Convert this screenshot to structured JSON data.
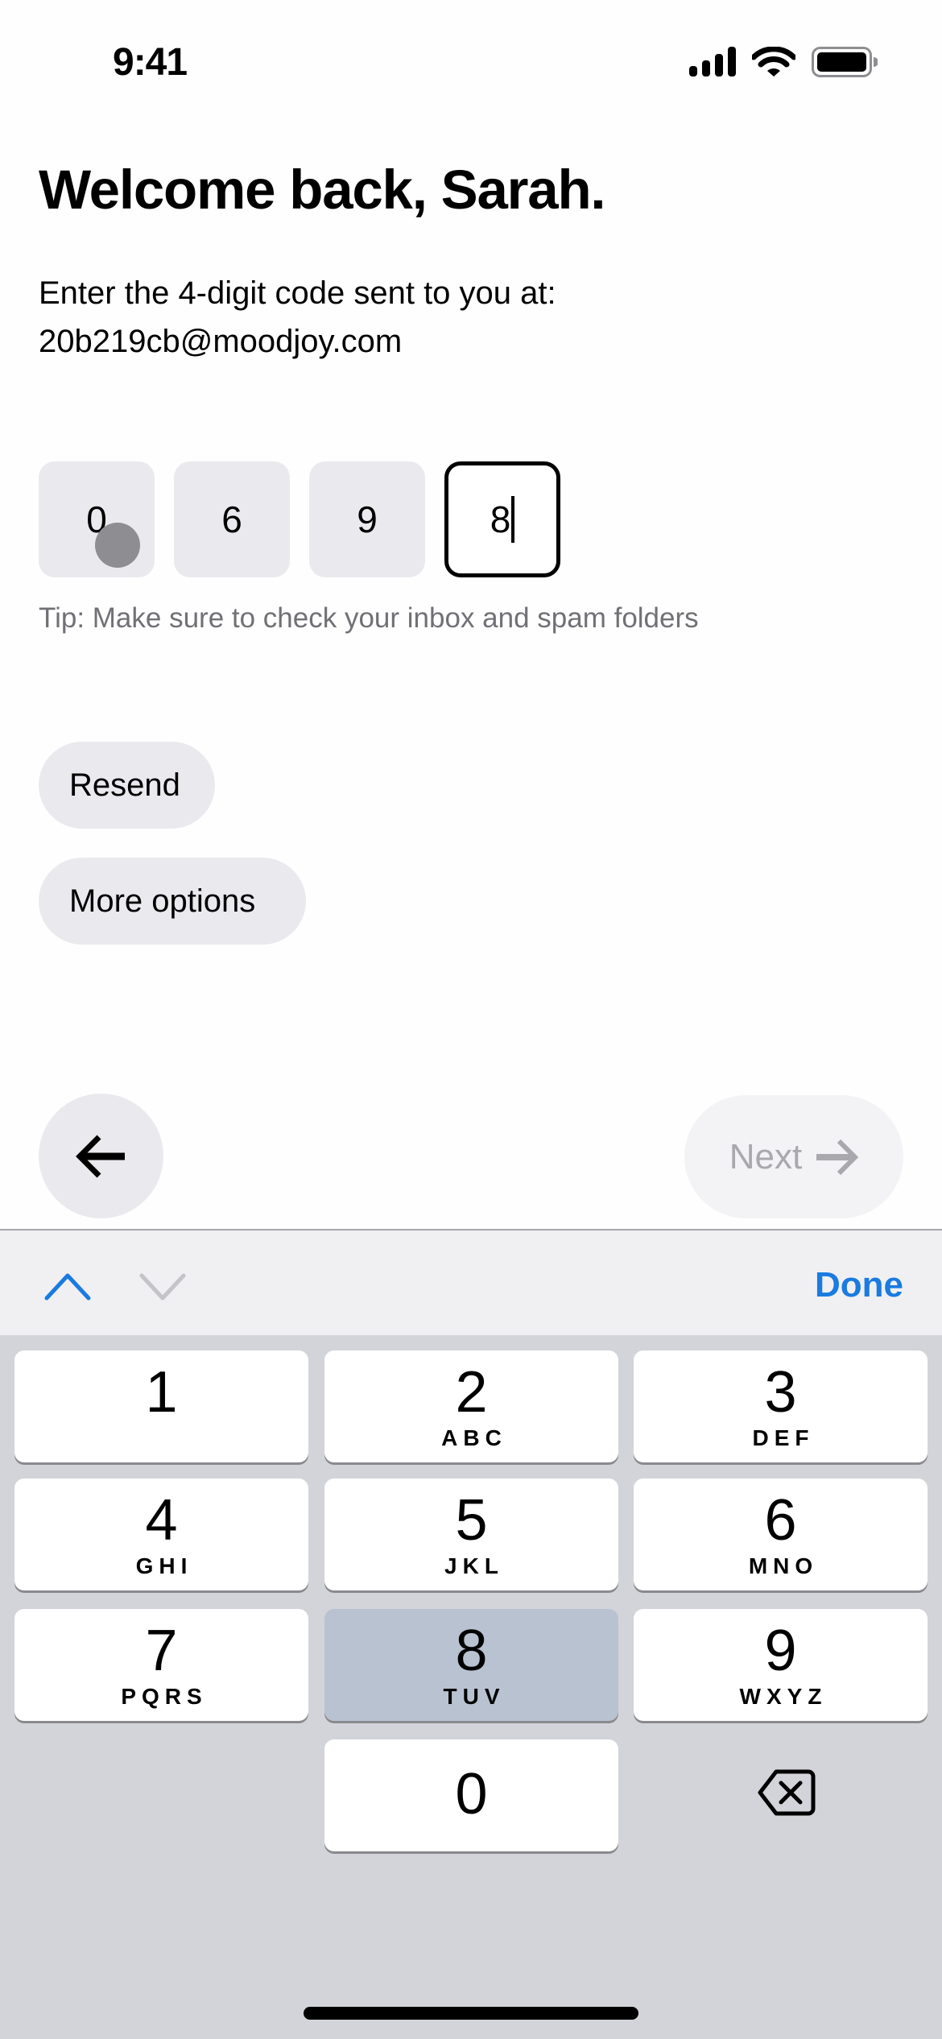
{
  "status_bar": {
    "time": "9:41",
    "icons": [
      "cellular-signal-icon",
      "wifi-icon",
      "battery-icon"
    ]
  },
  "header": {
    "title": "Welcome back, Sarah.",
    "instruction": "Enter the 4-digit code sent to you at:",
    "email": "20b219cb@moodjoy.com"
  },
  "code_input": {
    "digits": [
      "0",
      "6",
      "9",
      "8"
    ],
    "active_index": 3,
    "tip": "Tip: Make sure to check your inbox and spam folders"
  },
  "actions": {
    "resend_label": "Resend",
    "more_options_label": "More options"
  },
  "navigation": {
    "back_icon": "arrow-left-icon",
    "next_label": "Next",
    "next_icon": "arrow-right-icon",
    "next_enabled": false
  },
  "keyboard_toolbar": {
    "previous_icon": "chevron-up-icon",
    "next_icon": "chevron-down-icon",
    "done_label": "Done"
  },
  "keypad": {
    "keys": [
      {
        "digit": "1",
        "letters": ""
      },
      {
        "digit": "2",
        "letters": "ABC"
      },
      {
        "digit": "3",
        "letters": "DEF"
      },
      {
        "digit": "4",
        "letters": "GHI"
      },
      {
        "digit": "5",
        "letters": "JKL"
      },
      {
        "digit": "6",
        "letters": "MNO"
      },
      {
        "digit": "7",
        "letters": "PQRS"
      },
      {
        "digit": "8",
        "letters": "TUV"
      },
      {
        "digit": "9",
        "letters": "WXYZ"
      },
      {
        "digit": "0",
        "letters": ""
      }
    ],
    "pressed_key": "8",
    "delete_icon": "backspace-icon"
  },
  "colors": {
    "accent": "#1a7be0",
    "field_bg": "#eae9ed",
    "pressed_key": "#b8c2d1",
    "keyboard_bg": "#d3d4d9"
  }
}
